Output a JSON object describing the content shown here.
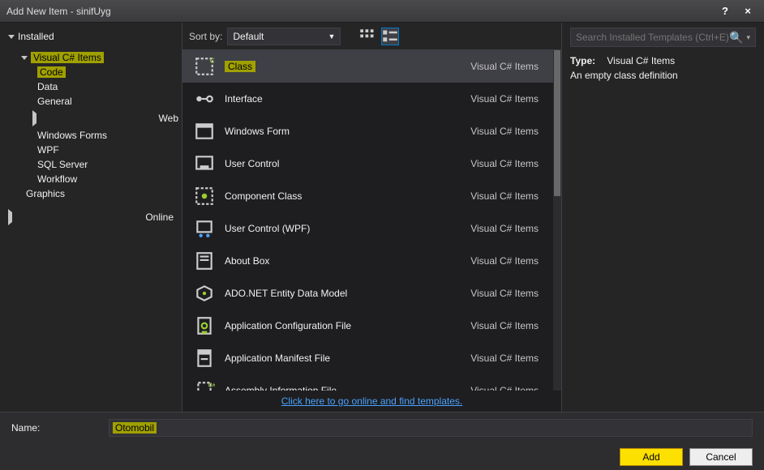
{
  "window": {
    "title": "Add New Item - sinifUyg",
    "help_tooltip": "?",
    "close_tooltip": "×"
  },
  "tree": {
    "installed": "Installed",
    "vcitems": "Visual C# Items",
    "code": "Code",
    "data": "Data",
    "general": "General",
    "web": "Web",
    "winforms": "Windows Forms",
    "wpf": "WPF",
    "sql": "SQL Server",
    "workflow": "Workflow",
    "graphics": "Graphics",
    "online": "Online"
  },
  "toolbar": {
    "sortby_label": "Sort by:",
    "sortby_value": "Default"
  },
  "search": {
    "placeholder": "Search Installed Templates (Ctrl+E)"
  },
  "info": {
    "type_label": "Type:",
    "type_value": "Visual C# Items",
    "desc": "An empty class definition"
  },
  "items": [
    {
      "name": "Class",
      "cat": "Visual C# Items",
      "sel": true,
      "hl": true
    },
    {
      "name": "Interface",
      "cat": "Visual C# Items"
    },
    {
      "name": "Windows Form",
      "cat": "Visual C# Items"
    },
    {
      "name": "User Control",
      "cat": "Visual C# Items"
    },
    {
      "name": "Component Class",
      "cat": "Visual C# Items"
    },
    {
      "name": "User Control (WPF)",
      "cat": "Visual C# Items"
    },
    {
      "name": "About Box",
      "cat": "Visual C# Items"
    },
    {
      "name": "ADO.NET Entity Data Model",
      "cat": "Visual C# Items"
    },
    {
      "name": "Application Configuration File",
      "cat": "Visual C# Items"
    },
    {
      "name": "Application Manifest File",
      "cat": "Visual C# Items"
    },
    {
      "name": "Assembly Information File",
      "cat": "Visual C# Items"
    }
  ],
  "online_link": "Click here to go online and find templates.",
  "footer": {
    "name_label": "Name:",
    "name_value": "Otomobil",
    "add": "Add",
    "cancel": "Cancel"
  }
}
